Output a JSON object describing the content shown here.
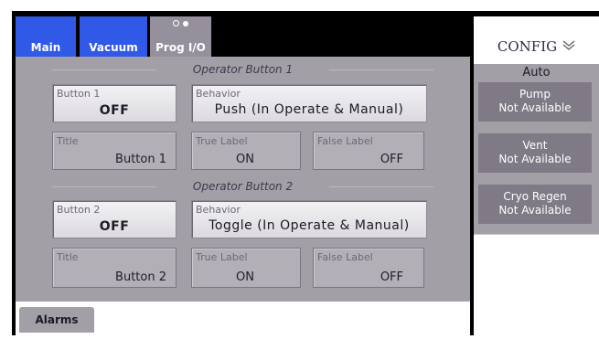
{
  "tabs": [
    {
      "label": "Main"
    },
    {
      "label": "Vacuum"
    },
    {
      "label": "Prog I/O"
    }
  ],
  "sections": [
    {
      "title": "Operator Button 1",
      "button_caption": "Button 1",
      "button_value": "OFF",
      "behavior_caption": "Behavior",
      "behavior_value": "Push (In Operate & Manual)",
      "title_caption": "Title",
      "title_value": "Button 1",
      "true_caption": "True Label",
      "true_value": "ON",
      "false_caption": "False Label",
      "false_value": "OFF"
    },
    {
      "title": "Operator Button 2",
      "button_caption": "Button 2",
      "button_value": "OFF",
      "behavior_caption": "Behavior",
      "behavior_value": "Toggle (In Operate & Manual)",
      "title_caption": "Title",
      "title_value": "Button 2",
      "true_caption": "True Label",
      "true_value": "ON",
      "false_caption": "False Label",
      "false_value": "OFF"
    }
  ],
  "bottom": {
    "alarms_label": "Alarms"
  },
  "config": {
    "header": "CONFIG",
    "chevron_icon": "chevron-down-double-icon",
    "mode": "Auto",
    "items": [
      {
        "name": "Pump",
        "status": "Not Available"
      },
      {
        "name": "Vent",
        "status": "Not Available"
      },
      {
        "name": "Cryo Regen",
        "status": "Not Available"
      }
    ]
  },
  "colors": {
    "tab_blue": "#2f59e6",
    "panel_gray": "#a39fa7",
    "item_gray": "#7f7a85"
  }
}
